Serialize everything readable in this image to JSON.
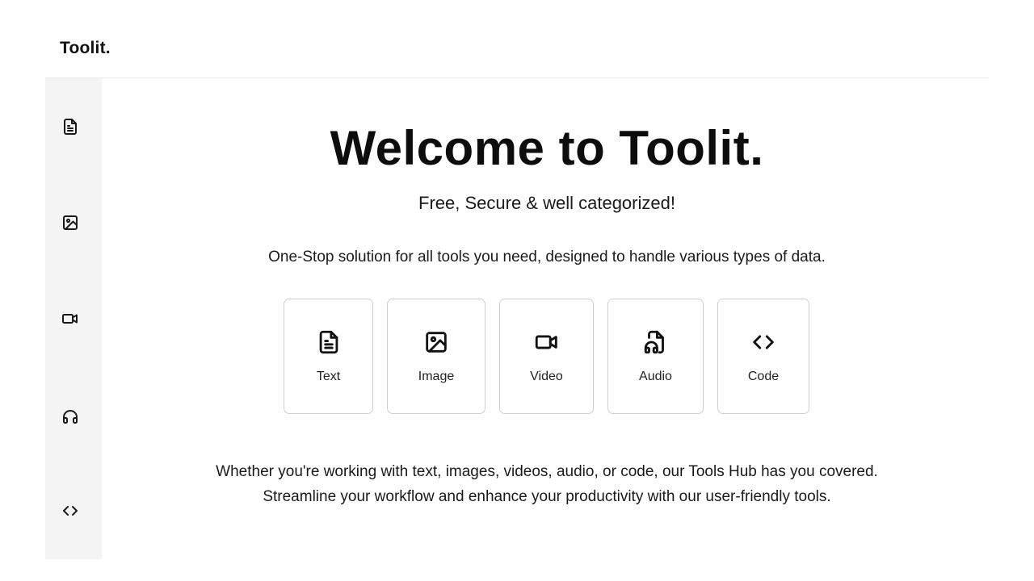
{
  "app": {
    "brand": "Toolit."
  },
  "sidebar": {
    "items": [
      {
        "icon": "text-file-icon"
      },
      {
        "icon": "image-icon"
      },
      {
        "icon": "video-camera-icon"
      },
      {
        "icon": "headphones-icon"
      },
      {
        "icon": "code-icon"
      }
    ]
  },
  "main": {
    "title": "Welcome to Toolit.",
    "subtitle": "Free, Secure & well categorized!",
    "description": "One-Stop solution for all tools you need, designed to handle various types of data.",
    "cards": [
      {
        "label": "Text",
        "icon": "text-file-icon"
      },
      {
        "label": "Image",
        "icon": "image-icon"
      },
      {
        "label": "Video",
        "icon": "video-camera-icon"
      },
      {
        "label": "Audio",
        "icon": "audio-file-icon"
      },
      {
        "label": "Code",
        "icon": "code-icon"
      }
    ],
    "footer_line1": "Whether you're working with text, images, videos, audio, or code, our Tools Hub has you covered.",
    "footer_line2": "Streamline your workflow and enhance your productivity with our user-friendly tools."
  }
}
